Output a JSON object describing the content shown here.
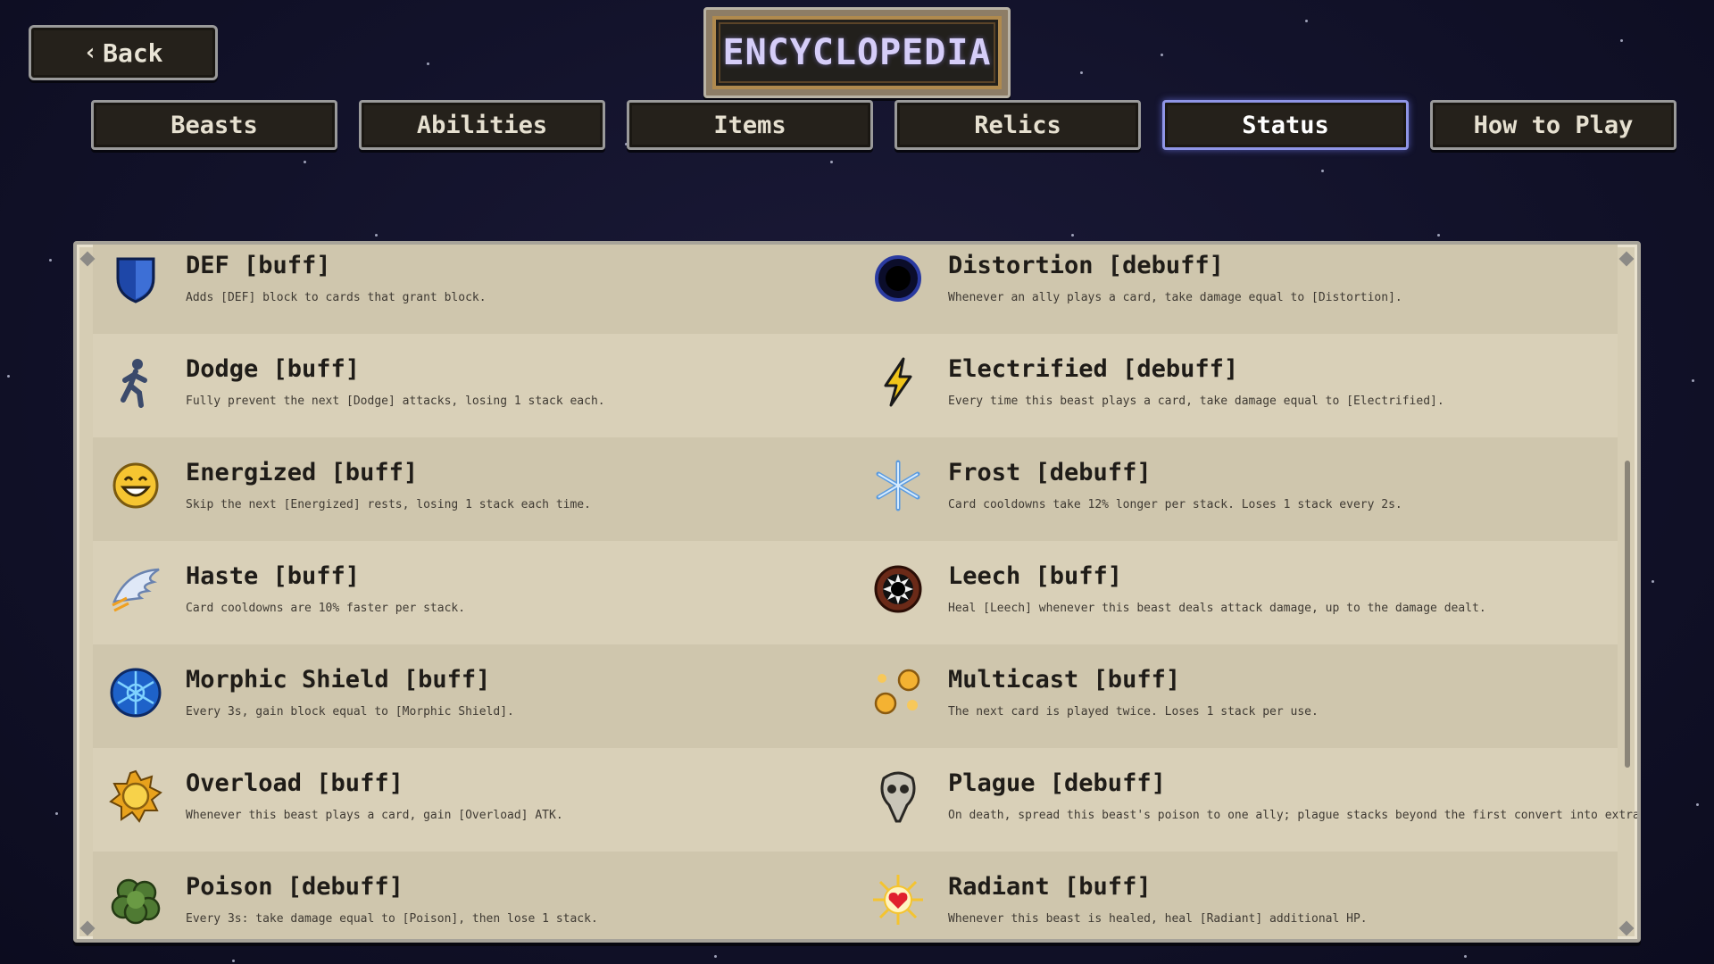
{
  "header": {
    "back_label": "Back",
    "title": "ENCYCLOPEDIA"
  },
  "tabs": [
    {
      "label": "Beasts",
      "active": false
    },
    {
      "label": "Abilities",
      "active": false
    },
    {
      "label": "Items",
      "active": false
    },
    {
      "label": "Relics",
      "active": false
    },
    {
      "label": "Status",
      "active": true
    },
    {
      "label": "How to Play",
      "active": false
    }
  ],
  "colors": {
    "background": "#12122a",
    "panel": "#d6cdb4",
    "active_tab_border": "#8f95e6",
    "title_text": "#d5cdf8"
  },
  "statuses": [
    [
      {
        "name": "DEF [buff]",
        "desc": "Adds [DEF] block to cards that grant block.",
        "icon": "shield-icon"
      },
      {
        "name": "Distortion [debuff]",
        "desc": "Whenever an ally plays a card, take damage equal to [Distortion].",
        "icon": "void-orb-icon"
      }
    ],
    [
      {
        "name": "Dodge [buff]",
        "desc": "Fully prevent the next [Dodge] attacks, losing 1 stack each.",
        "icon": "running-figure-icon"
      },
      {
        "name": "Electrified [debuff]",
        "desc": "Every time this beast plays a card, take damage equal to [Electrified].",
        "icon": "lightning-icon"
      }
    ],
    [
      {
        "name": "Energized [buff]",
        "desc": "Skip the next [Energized] rests, losing 1 stack each time.",
        "icon": "grinning-face-icon"
      },
      {
        "name": "Frost [debuff]",
        "desc": "Card cooldowns take 12% longer per stack. Loses 1 stack every 2s.",
        "icon": "snowflake-icon"
      }
    ],
    [
      {
        "name": "Haste [buff]",
        "desc": "Card cooldowns are 10% faster per stack.",
        "icon": "winged-icon"
      },
      {
        "name": "Leech [buff]",
        "desc": "Heal [Leech] whenever this beast deals attack damage, up to the damage dealt.",
        "icon": "leech-mouth-icon"
      }
    ],
    [
      {
        "name": "Morphic Shield [buff]",
        "desc": "Every 3s, gain block equal to [Morphic Shield].",
        "icon": "hex-shield-icon"
      },
      {
        "name": "Multicast [buff]",
        "desc": "The next card is played twice. Loses 1 stack per use.",
        "icon": "orbs-icon"
      }
    ],
    [
      {
        "name": "Overload [buff]",
        "desc": "Whenever this beast plays a card, gain [Overload] ATK.",
        "icon": "sun-coin-icon"
      },
      {
        "name": "Plague [debuff]",
        "desc": "On death, spread this beast's poison to one ally; plague stacks beyond the first convert into extra poison.",
        "icon": "plague-mask-icon"
      }
    ],
    [
      {
        "name": "Poison [debuff]",
        "desc": "Every 3s: take damage equal to [Poison], then lose 1 stack.",
        "icon": "poison-cloud-icon"
      },
      {
        "name": "Radiant [buff]",
        "desc": "Whenever this beast is healed, heal [Radiant] additional HP.",
        "icon": "radiant-heart-icon"
      }
    ]
  ]
}
